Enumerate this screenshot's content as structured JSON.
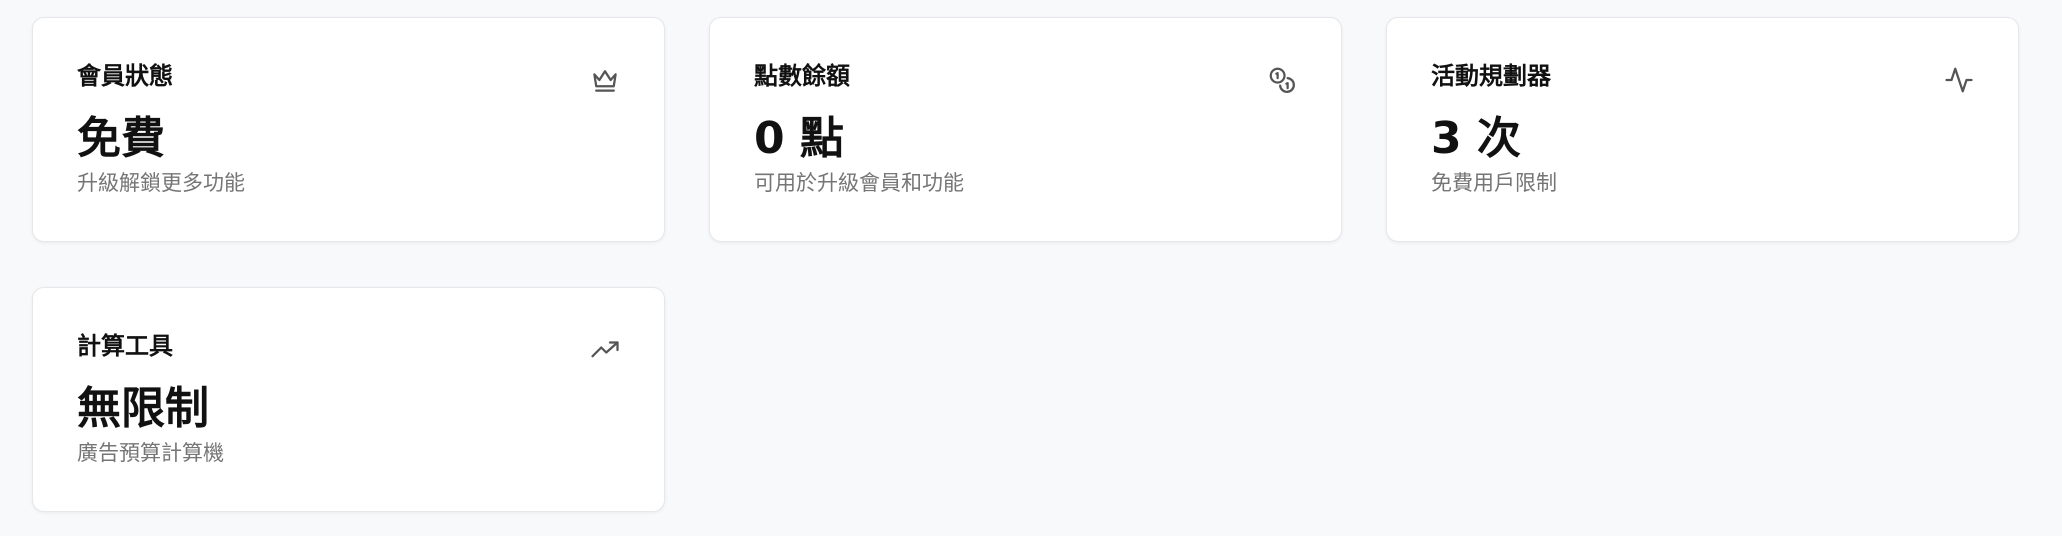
{
  "cards": [
    {
      "title": "會員狀態",
      "value": "免費",
      "description": "升級解鎖更多功能",
      "icon": "crown-icon"
    },
    {
      "title": "點數餘額",
      "value": "0 點",
      "description": "可用於升級會員和功能",
      "icon": "coins-icon"
    },
    {
      "title": "活動規劃器",
      "value": "3 次",
      "description": "免費用戶限制",
      "icon": "activity-icon"
    },
    {
      "title": "計算工具",
      "value": "無限制",
      "description": "廣告預算計算機",
      "icon": "trending-up-icon"
    }
  ],
  "colors": {
    "page_background": "#f8f9fa",
    "card_background": "#ffffff",
    "card_border": "#e5e7eb",
    "title_text": "#111111",
    "description_text": "#757575",
    "icon": "#555555"
  }
}
